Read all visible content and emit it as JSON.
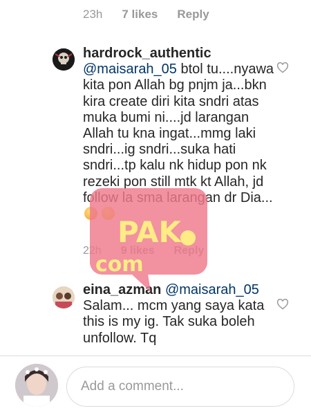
{
  "top_meta": {
    "time": "23h",
    "likes": "7 likes",
    "reply": "Reply"
  },
  "comments": [
    {
      "username": "hardrock_authentic",
      "mention": "@maisarah_05",
      "text": " btol tu....nyawa kita pon Allah bg pnjm ja...bkn kira create diri kita sndri atas muka bumi ni....jd larangan Allah tu kna ingat...mmg laki sndri...ig sndri...suka hati sndri...tp kalu nk hidup pon nk rezeki pon still mtk kt Allah, jd follow la sma larangan dr Dia...",
      "time": "22h",
      "likes": "9 likes",
      "reply": "Reply"
    },
    {
      "username": "eina_azman",
      "mention": "@maisarah_05",
      "text": "Salam... mcm yang saya kata this is my ig. Tak suka boleh unfollow. Tq"
    }
  ],
  "composer": {
    "placeholder": "Add a comment..."
  },
  "watermark": {
    "line1": "PAK",
    "line2": "com"
  },
  "colors": {
    "mention": "#003569",
    "meta": "#999999",
    "text": "#262626",
    "watermark": "#f07a8c"
  }
}
